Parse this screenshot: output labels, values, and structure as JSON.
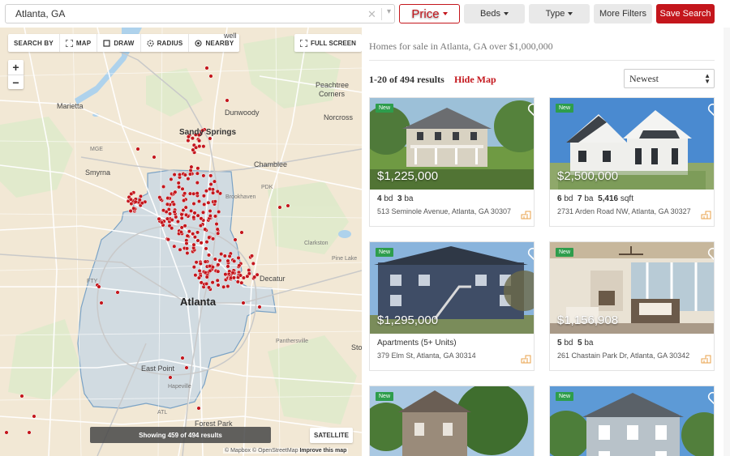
{
  "search": {
    "value": "Atlanta, GA",
    "clear_icon": "close-icon",
    "dropdown_icon": "chevron-down-icon"
  },
  "filters": {
    "price": "Price",
    "beds": "Beds",
    "type": "Type",
    "more": "More Filters",
    "save": "Save Search"
  },
  "map": {
    "tools": {
      "search_by": "SEARCH BY",
      "map": "MAP",
      "draw": "DRAW",
      "radius": "RADIUS",
      "nearby": "NEARBY"
    },
    "full_screen": "FULL SCREEN",
    "zoom_in": "+",
    "zoom_out": "−",
    "labels": {
      "sandy_springs": "Sandy Springs",
      "dunwoody": "Dunwoody",
      "peachtree_corners_1": "Peachtree",
      "peachtree_corners_2": "Corners",
      "norcross": "Norcross",
      "marietta": "Marietta",
      "smyrna": "Smyrna",
      "chamblee": "Chamblee",
      "brookhaven": "Brookhaven",
      "clarkston": "Clarkston",
      "pine_lake": "Pine Lake",
      "decatur": "Decatur",
      "atlanta": "Atlanta",
      "east_point": "East Point",
      "forest_park": "Forest Park",
      "hapeville": "Hapeville",
      "panthersville": "Panthersville",
      "mge": "MGE",
      "pdk": "PDK",
      "fty": "FTY",
      "atl": "ATL",
      "well": "well",
      "sto": "Sto"
    },
    "showing": "Showing 459 of 494 results",
    "satellite": "SATELLITE",
    "attribution": {
      "mapbox": "© Mapbox",
      "osm": "© OpenStreetMap",
      "improve": "Improve this map"
    },
    "pin_color": "#c4161c"
  },
  "results": {
    "headline": "Homes for sale in Atlanta, GA over $1,000,000",
    "count": "1-20 of 494 results",
    "hide_map": "Hide Map",
    "sort": "Newest",
    "listings": [
      {
        "badge": "New",
        "price": "$1,225,000",
        "beds": "4",
        "beds_unit": "bd",
        "baths": "3",
        "baths_unit": "ba",
        "sqft": "",
        "sqft_unit": "",
        "type": "",
        "address": "513 Seminole Avenue, Atlanta, GA 30307"
      },
      {
        "badge": "New",
        "price": "$2,500,000",
        "beds": "6",
        "beds_unit": "bd",
        "baths": "7",
        "baths_unit": "ba",
        "sqft": "5,416",
        "sqft_unit": "sqft",
        "type": "",
        "address": "2731 Arden Road NW, Atlanta, GA 30327"
      },
      {
        "badge": "New",
        "price": "$1,295,000",
        "beds": "",
        "beds_unit": "",
        "baths": "",
        "baths_unit": "",
        "sqft": "",
        "sqft_unit": "",
        "type": "Apartments (5+ Units)",
        "address": "379 Elm St, Atlanta, GA 30314"
      },
      {
        "badge": "New",
        "price": "$1,156,908",
        "beds": "5",
        "beds_unit": "bd",
        "baths": "5",
        "baths_unit": "ba",
        "sqft": "",
        "sqft_unit": "",
        "type": "",
        "address": "261 Chastain Park Dr, Atlanta, GA 30342"
      },
      {
        "badge": "New"
      },
      {
        "badge": "New"
      }
    ]
  },
  "colors": {
    "accent": "#c4161c",
    "badge": "#2e9d4c"
  }
}
